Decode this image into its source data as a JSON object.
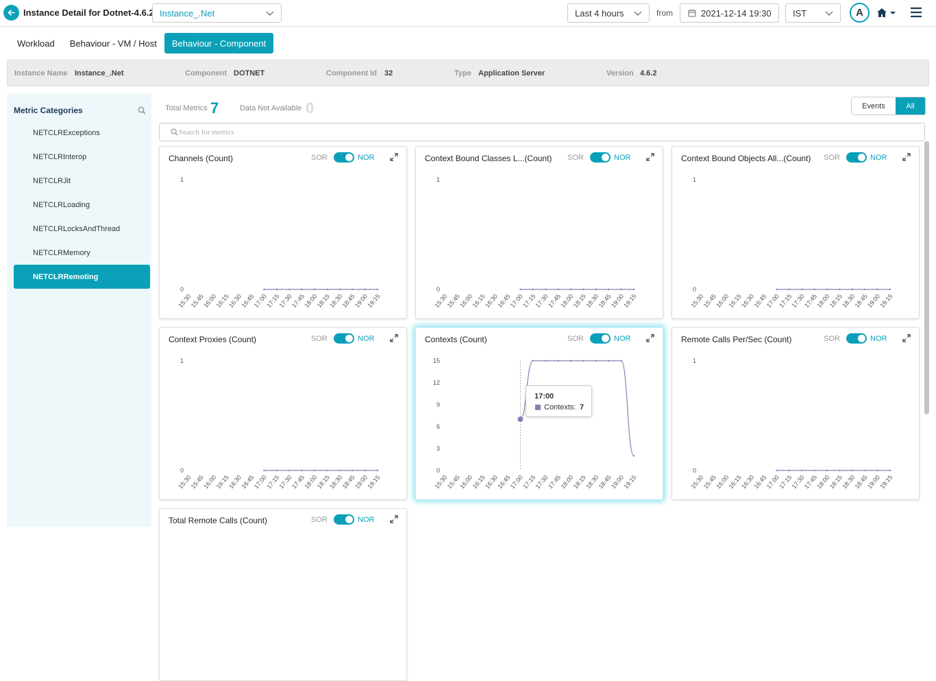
{
  "header": {
    "title": "Instance Detail for Dotnet-4.6.2",
    "instance_select": ".Net",
    "instance_select_prefix": "Instance_",
    "time_range": "Last 4 hours",
    "from_label": "from",
    "from_datetime": "2021-12-14 19:30",
    "timezone": "IST",
    "avatar_letter": "A"
  },
  "tabs": [
    "Workload",
    "Behaviour - VM / Host",
    "Behaviour - Component"
  ],
  "info": {
    "instance_name_label": "Instance Name",
    "instance_name": "Instance_.Net",
    "component_label": "Component",
    "component": "DOTNET",
    "component_id_label": "Component Id",
    "component_id": "32",
    "type_label": "Type",
    "type": "Application Server",
    "version_label": "Version",
    "version": "4.6.2"
  },
  "sidebar": {
    "title": "Metric Categories",
    "items": [
      "NETCLRExceptions",
      "NETCLRInterop",
      "NETCLRJit",
      "NETCLRLoading",
      "NETCLRLocksAndThread",
      "NETCLRMemory",
      "NETCLRRemoting"
    ],
    "active_index": 6
  },
  "summary": {
    "total_label": "Total Metrics",
    "total": "7",
    "na_label": "Data Not Available",
    "na": "0",
    "events_btn": "Events",
    "all_btn": "All",
    "search_placeholder": "Search for metrics"
  },
  "card_controls": {
    "sor": "SOR",
    "nor": "NOR"
  },
  "colors": {
    "accent": "#0aa0b8",
    "series": "#8c7fb4",
    "sidebar_bg": "#eef8fa"
  },
  "tooltip": {
    "time": "17:00",
    "label": "Contexts:",
    "value": "7"
  },
  "chart_data": [
    {
      "type": "line",
      "title": "Channels (Count)",
      "x": [
        "15:30",
        "15:45",
        "16:00",
        "16:15",
        "16:30",
        "16:45",
        "17:00",
        "17:15",
        "17:30",
        "17:45",
        "18:00",
        "18:15",
        "18:30",
        "18:45",
        "19:00",
        "19:15"
      ],
      "yticks": [
        "0",
        "1"
      ],
      "ylim": [
        0,
        1
      ],
      "series": [
        {
          "values": [
            null,
            null,
            null,
            null,
            null,
            null,
            0,
            0,
            0,
            0,
            0,
            0,
            0,
            0,
            0,
            0
          ]
        }
      ]
    },
    {
      "type": "line",
      "title": "Context Bound Classes L...(Count)",
      "x": [
        "15:30",
        "15:45",
        "16:00",
        "16:15",
        "16:30",
        "16:45",
        "17:00",
        "17:15",
        "17:30",
        "17:45",
        "18:00",
        "18:15",
        "18:30",
        "18:45",
        "19:00",
        "19:15"
      ],
      "yticks": [
        "0",
        "1"
      ],
      "ylim": [
        0,
        1
      ],
      "series": [
        {
          "values": [
            null,
            null,
            null,
            null,
            null,
            null,
            0,
            0,
            0,
            0,
            0,
            0,
            0,
            0,
            0,
            0
          ]
        }
      ]
    },
    {
      "type": "line",
      "title": "Context Bound Objects All...(Count)",
      "x": [
        "15:30",
        "15:45",
        "16:00",
        "16:15",
        "16:30",
        "16:45",
        "17:00",
        "17:15",
        "17:30",
        "17:45",
        "18:00",
        "18:15",
        "18:30",
        "18:45",
        "19:00",
        "19:15"
      ],
      "yticks": [
        "0",
        "1"
      ],
      "ylim": [
        0,
        1
      ],
      "series": [
        {
          "values": [
            null,
            null,
            null,
            null,
            null,
            null,
            0,
            0,
            0,
            0,
            0,
            0,
            0,
            0,
            0,
            0
          ]
        }
      ]
    },
    {
      "type": "line",
      "title": "Context Proxies (Count)",
      "x": [
        "15:30",
        "15:45",
        "16:00",
        "16:15",
        "16:30",
        "16:45",
        "17:00",
        "17:15",
        "17:30",
        "17:45",
        "18:00",
        "18:15",
        "18:30",
        "18:45",
        "19:00",
        "19:15"
      ],
      "yticks": [
        "0",
        "1"
      ],
      "ylim": [
        0,
        1
      ],
      "series": [
        {
          "values": [
            null,
            null,
            null,
            null,
            null,
            null,
            0,
            0,
            0,
            0,
            0,
            0,
            0,
            0,
            0,
            0
          ]
        }
      ]
    },
    {
      "type": "line",
      "title": "Contexts (Count)",
      "x": [
        "15:30",
        "15:45",
        "16:00",
        "16:15",
        "16:30",
        "16:45",
        "17:00",
        "17:15",
        "17:30",
        "17:45",
        "18:00",
        "18:15",
        "18:30",
        "18:45",
        "19:00",
        "19:15"
      ],
      "yticks": [
        "0",
        "3",
        "6",
        "9",
        "12",
        "15"
      ],
      "ylim": [
        0,
        15
      ],
      "highlight_index": 6,
      "series": [
        {
          "values": [
            null,
            null,
            null,
            null,
            null,
            null,
            7,
            15,
            15,
            15,
            15,
            15,
            15,
            15,
            15,
            2
          ]
        }
      ]
    },
    {
      "type": "line",
      "title": "Remote Calls Per/Sec (Count)",
      "x": [
        "15:30",
        "15:45",
        "16:00",
        "16:15",
        "16:30",
        "16:45",
        "17:00",
        "17:15",
        "17:30",
        "17:45",
        "18:00",
        "18:15",
        "18:30",
        "18:45",
        "19:00",
        "19:15"
      ],
      "yticks": [
        "0",
        "1"
      ],
      "ylim": [
        0,
        1
      ],
      "series": [
        {
          "values": [
            null,
            null,
            null,
            null,
            null,
            null,
            0,
            0,
            0,
            0,
            0,
            0,
            0,
            0,
            0,
            0
          ]
        }
      ]
    },
    {
      "type": "line",
      "title": "Total Remote Calls (Count)",
      "x": [],
      "yticks": [],
      "series": []
    }
  ]
}
